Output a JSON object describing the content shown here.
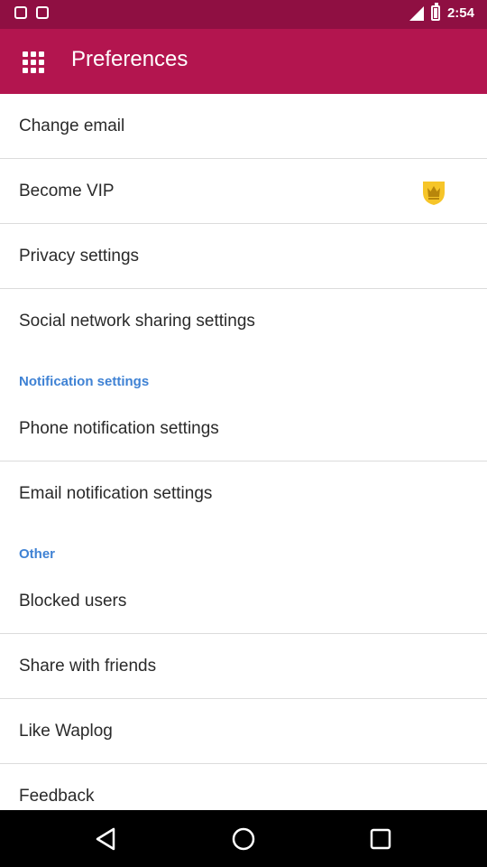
{
  "status_bar": {
    "time": "2:54",
    "icons": [
      "notification-icon",
      "notification-icon",
      "signal-icon",
      "battery-icon"
    ]
  },
  "app_bar": {
    "title": "Preferences",
    "menu_icon": "apps-grid-icon"
  },
  "items": [
    {
      "type": "item",
      "label": "Change email"
    },
    {
      "type": "item",
      "label": "Become VIP",
      "icon": "crown-icon"
    },
    {
      "type": "item",
      "label": "Privacy settings"
    },
    {
      "type": "item",
      "label": "Social network sharing settings"
    },
    {
      "type": "header",
      "label": "Notification settings"
    },
    {
      "type": "item",
      "label": "Phone notification settings"
    },
    {
      "type": "item",
      "label": "Email notification settings"
    },
    {
      "type": "header",
      "label": "Other"
    },
    {
      "type": "item",
      "label": "Blocked users"
    },
    {
      "type": "item",
      "label": "Share with friends"
    },
    {
      "type": "item",
      "label": "Like Waplog"
    },
    {
      "type": "item",
      "label": "Feedback"
    }
  ],
  "nav_bar": {
    "icons": [
      "back-icon",
      "home-icon",
      "recent-apps-icon"
    ]
  },
  "colors": {
    "status_bar": "#8f0f42",
    "app_bar": "#b3154f",
    "section_header": "#3f82d4",
    "crown": "#f6c529"
  }
}
